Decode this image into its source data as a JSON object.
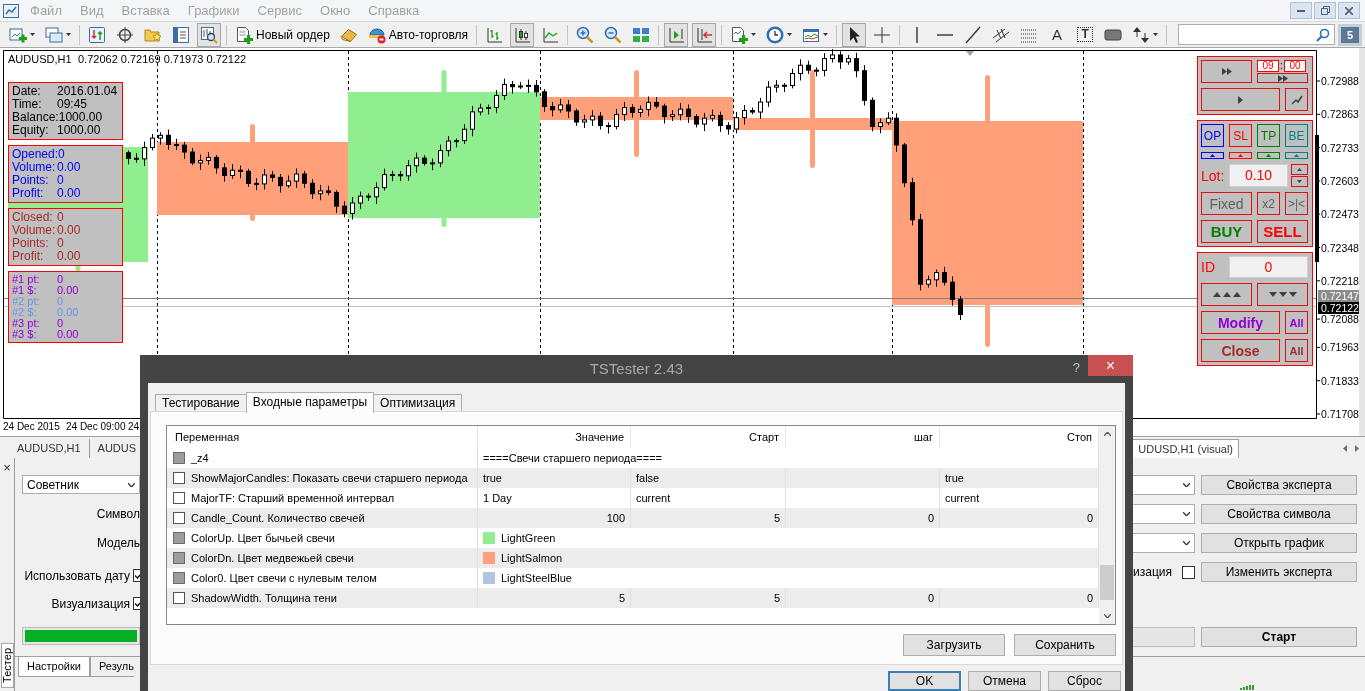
{
  "menu": [
    "Файл",
    "Вид",
    "Вставка",
    "Графики",
    "Сервис",
    "Окно",
    "Справка"
  ],
  "toolbar": {
    "items": [
      {
        "pressed": false
      },
      {
        "pressed": false
      },
      {
        "pressed": false
      },
      {
        "pressed": false
      },
      {
        "pressed": false
      },
      {
        "pressed": false
      },
      {
        "pressed": true
      },
      {
        "label": "Новый ордер",
        "pressed": false
      },
      {
        "pressed": false
      },
      {
        "label": "Авто-торговля",
        "pressed": false
      },
      {
        "pressed": false
      },
      {
        "pressed": true
      },
      {
        "pressed": false
      },
      {
        "pressed": false
      },
      {
        "pressed": false
      },
      {
        "pressed": false
      },
      {
        "pressed": true
      },
      {
        "pressed": true
      },
      {
        "pressed": false
      },
      {
        "pressed": false
      },
      {
        "pressed": false
      },
      {
        "pressed": true
      },
      {
        "pressed": false
      },
      {
        "pressed": false
      },
      {
        "pressed": false
      },
      {
        "pressed": false
      },
      {
        "pressed": false
      },
      {
        "pressed": false
      },
      {
        "label": "A",
        "pressed": false
      },
      {
        "label": "T",
        "pressed": false
      },
      {
        "pressed": false
      },
      {
        "pressed": false
      }
    ],
    "messages": "5"
  },
  "chart": {
    "symbol": "AUDUSD,H1",
    "ohlc": "0.72062 0.72169 0.71973 0.72122",
    "price_ticks": [
      "0.72988",
      "0.72863",
      "0.72733",
      "0.72603",
      "0.72473",
      "0.72348",
      "0.72218",
      "0.72088",
      "0.71963",
      "0.71833",
      "0.71708"
    ],
    "ask": "0.72147",
    "bid": "0.72122",
    "time_ticks": [
      "24 Dec 2015",
      "24 Dec 09:00",
      "24"
    ]
  },
  "info_panels": [
    {
      "kind": "normal",
      "color": "#000000",
      "lines": [
        {
          "label": "Date:",
          "value": "2016.01.04"
        },
        {
          "label": "Time:",
          "value": "09:45"
        },
        {
          "label": "Balance:",
          "value": "1000.00"
        },
        {
          "label": "Equity:",
          "value": "1000.00"
        }
      ]
    },
    {
      "kind": "normal",
      "color": "#0000ff",
      "lines": [
        {
          "label": "Opened:",
          "value": "0"
        },
        {
          "label": "Volume:",
          "value": "0.00"
        },
        {
          "label": "Points:",
          "value": "0"
        },
        {
          "label": "Profit:",
          "value": "0.00"
        }
      ]
    },
    {
      "kind": "normal",
      "color": "#a52a2a",
      "lines": [
        {
          "label": "Closed:",
          "value": "0"
        },
        {
          "label": "Volume:",
          "value": "0.00"
        },
        {
          "label": "Points:",
          "value": "0"
        },
        {
          "label": "Profit:",
          "value": "0.00"
        }
      ]
    },
    {
      "kind": "compact",
      "lines": [
        {
          "label": "#1 pt:",
          "value": "0",
          "color": "#9400d3"
        },
        {
          "label": "#1 $:",
          "value": "0.00",
          "color": "#9400d3"
        },
        {
          "label": "#2 pt:",
          "value": "0",
          "color": "#6495ed"
        },
        {
          "label": "#2 $:",
          "value": "0.00",
          "color": "#6495ed"
        },
        {
          "label": "#3 pt:",
          "value": "0",
          "color": "#9400d3"
        },
        {
          "label": "#3 $:",
          "value": "0.00",
          "color": "#9400d3"
        }
      ]
    }
  ],
  "trade_panel": {
    "time_fields": [
      "09",
      "00"
    ],
    "time_separator": ":",
    "markers": [
      {
        "label": "OP",
        "color": "#0000ff"
      },
      {
        "label": "SL",
        "color": "#ff0000"
      },
      {
        "label": "TP",
        "color": "#008000"
      },
      {
        "label": "BE",
        "color": "#008080"
      }
    ],
    "lot_label": "Lot:",
    "lot_value": "0.10",
    "mode_buttons": [
      "Fixed",
      "x2",
      ">|<"
    ],
    "buy": "BUY",
    "sell": "SELL",
    "id_label": "ID",
    "id_value": "0",
    "modify": "Modify",
    "modify_all": "All",
    "close": "Close",
    "close_all": "All"
  },
  "chart_tabs": [
    {
      "label": "AUDUSD,H1",
      "selected": false
    },
    {
      "label": "AUDUS",
      "selected": false
    },
    {
      "label": "UDUSD,H1 (visual)",
      "selected": true
    }
  ],
  "tester": {
    "close": "×",
    "side_tab": "Тестер",
    "expert": "Советник",
    "labels": [
      "Символ",
      "Модель"
    ],
    "options": [
      {
        "label": "Использовать дату",
        "checked": true
      },
      {
        "label": "Визуализация",
        "checked": true
      }
    ],
    "progress": {
      "level": 1
    },
    "right_option": {
      "label": "изация",
      "checked": false
    },
    "buttons": [
      "Свойства эксперта",
      "Свойства символа",
      "Открыть график",
      "Изменить эксперта"
    ],
    "start": "Старт",
    "tabs": [
      {
        "label": "Настройки",
        "selected": true
      },
      {
        "label": "Резуль",
        "selected": false
      }
    ]
  },
  "dialog": {
    "title": "TSTester 2.43",
    "help": "?",
    "close": "×",
    "tabs": [
      {
        "label": "Тестирование",
        "selected": false
      },
      {
        "label": "Входные параметры",
        "selected": true
      },
      {
        "label": "Оптимизация",
        "selected": false
      }
    ],
    "columns": [
      "Переменная",
      "Значение",
      "Старт",
      "шаг",
      "Стоп"
    ],
    "rows": [
      {
        "kind": "separator",
        "name": "_z4",
        "checked": false,
        "disabled": true,
        "value": "====Свечи старшего периода===="
      },
      {
        "kind": "text",
        "name": "ShowMajorCandles: Показать свечи старшего периода",
        "checked": false,
        "disabled": false,
        "value": "true",
        "start": "false",
        "stop": "true"
      },
      {
        "kind": "text",
        "name": "MajorTF: Старший временной интервал",
        "checked": false,
        "disabled": false,
        "value": "1 Day",
        "start": "current",
        "stop": "current"
      },
      {
        "kind": "number",
        "name": "Candle_Count. Количество свечей",
        "checked": false,
        "disabled": false,
        "value": "100",
        "start": "5",
        "step": "0",
        "stop": "0"
      },
      {
        "kind": "color",
        "name": "ColorUp. Цвет бычьей свечи",
        "checked": false,
        "disabled": true,
        "value": "LightGreen",
        "color": "#90ee90"
      },
      {
        "kind": "color",
        "name": "ColorDn. Цвет медвежьей свечи",
        "checked": false,
        "disabled": true,
        "value": "LightSalmon",
        "color": "#ffa07a"
      },
      {
        "kind": "color",
        "name": "Color0. Цвет свечи с нулевым телом",
        "checked": false,
        "disabled": true,
        "value": "LightSteelBlue",
        "color": "#b0c4de"
      },
      {
        "kind": "number",
        "name": "ShadowWidth. Толщина тени",
        "checked": false,
        "disabled": false,
        "value": "5",
        "start": "5",
        "step": "0",
        "stop": "0"
      }
    ],
    "actions": [
      "Загрузить",
      "Сохранить"
    ],
    "footer": [
      {
        "label": "OK",
        "focused": true
      },
      {
        "label": "Отмена",
        "focused": false
      },
      {
        "label": "Сброс",
        "focused": false
      }
    ]
  }
}
